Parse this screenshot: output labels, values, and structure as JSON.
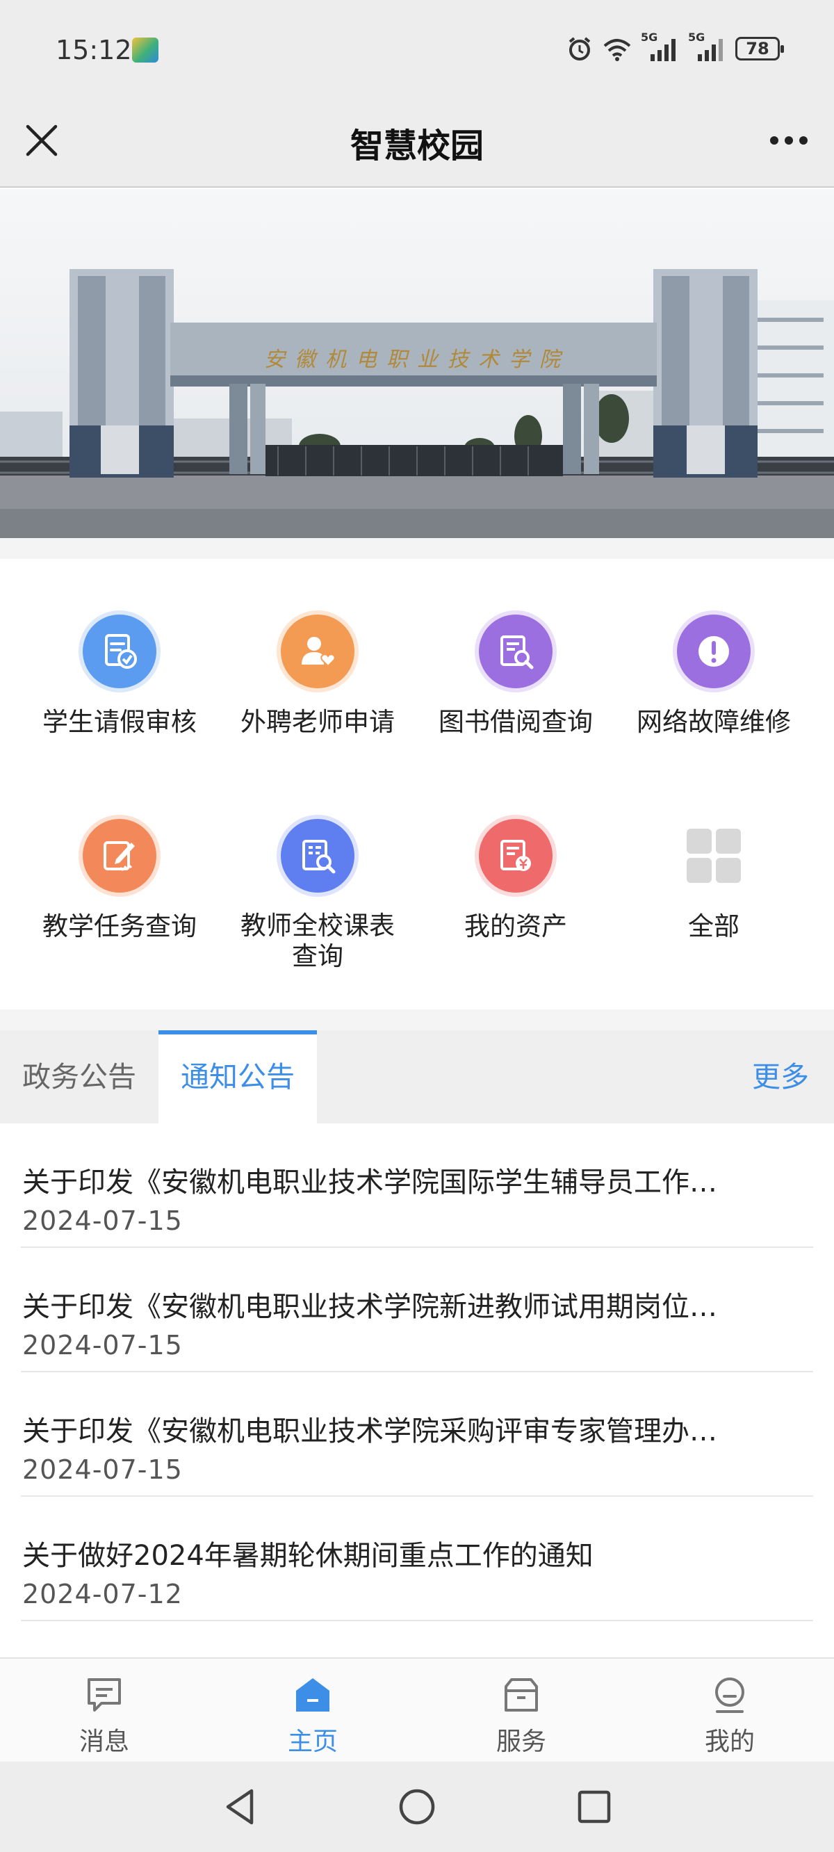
{
  "status": {
    "time": "15:12",
    "battery": "78",
    "signal1": "5G",
    "signal2": "5G"
  },
  "nav": {
    "title": "智慧校园"
  },
  "banner": {
    "gate_text": "安徽机电职业技术学院"
  },
  "apps": [
    {
      "label": "学生请假审核",
      "icon": "leave-approval-icon",
      "color": "#5b9cf0"
    },
    {
      "label": "外聘老师申请",
      "icon": "teacher-apply-icon",
      "color": "#f39a53"
    },
    {
      "label": "图书借阅查询",
      "icon": "book-search-icon",
      "color": "#9b6fe0"
    },
    {
      "label": "网络故障维修",
      "icon": "alert-icon",
      "color": "#9b6fe0"
    },
    {
      "label": "教学任务查询",
      "icon": "task-edit-icon",
      "color": "#f3895a"
    },
    {
      "label": "教师全校课表查询",
      "label_line1": "教师全校课表",
      "label_line2": "查询",
      "icon": "schedule-search-icon",
      "color": "#5f7ff0"
    },
    {
      "label": "我的资产",
      "icon": "asset-icon",
      "color": "#ef6a6a"
    },
    {
      "label": "全部",
      "icon": "grid-icon",
      "color": "#d8d8d8"
    }
  ],
  "tabs": {
    "gov": "政务公告",
    "notice": "通知公告",
    "more": "更多"
  },
  "news": [
    {
      "title": "关于印发《安徽机电职业技术学院国际学生辅导员工作…",
      "date": "2024-07-15"
    },
    {
      "title": "关于印发《安徽机电职业技术学院新进教师试用期岗位…",
      "date": "2024-07-15"
    },
    {
      "title": "关于印发《安徽机电职业技术学院采购评审专家管理办…",
      "date": "2024-07-15"
    },
    {
      "title": "关于做好2024年暑期轮休期间重点工作的通知",
      "date": "2024-07-12"
    }
  ],
  "tabbar": {
    "messages": "消息",
    "home": "主页",
    "services": "服务",
    "mine": "我的"
  },
  "colors": {
    "accent": "#3d8ee6"
  }
}
